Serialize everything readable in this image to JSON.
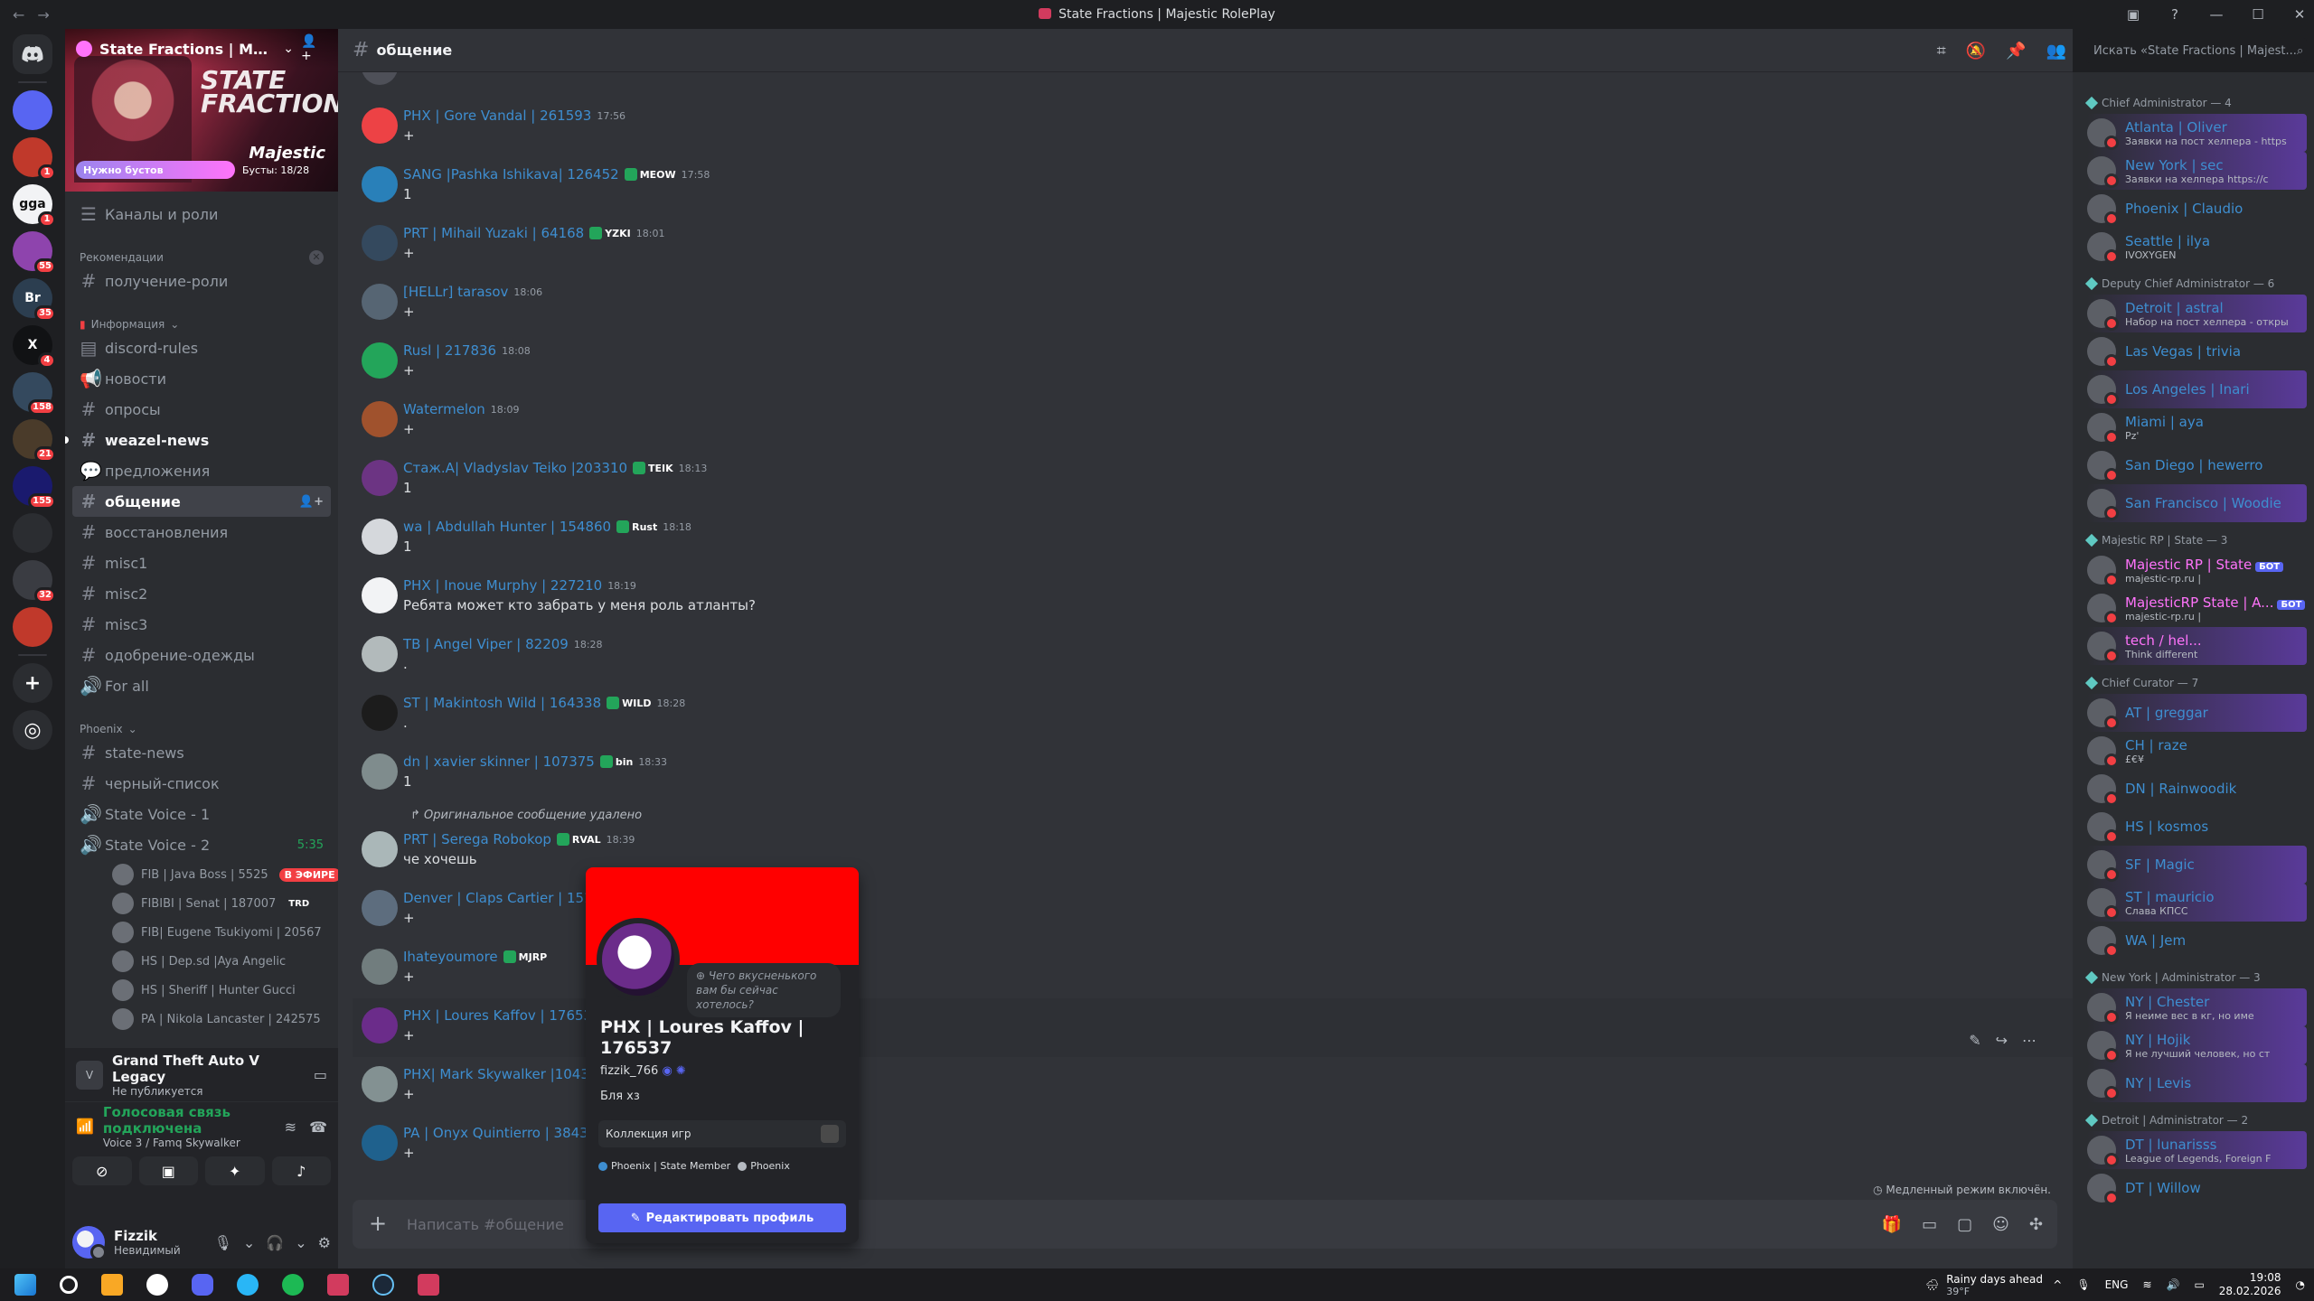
{
  "window": {
    "title": "State Fractions | Majestic RolePlay"
  },
  "guilds": [
    {
      "label": "",
      "color": "#5865f2",
      "badge": ""
    },
    {
      "label": "",
      "color": "#c0392b",
      "badge": "1"
    },
    {
      "label": "gga",
      "color": "#f2f3f5",
      "badge": "1"
    },
    {
      "label": "",
      "color": "#8e44ad",
      "badge": "55"
    },
    {
      "label": "Br",
      "color": "#2c3e50",
      "badge": "35"
    },
    {
      "label": "X",
      "color": "#111214",
      "badge": "4"
    },
    {
      "label": "",
      "color": "#34495e",
      "badge": "158"
    },
    {
      "label": "",
      "color": "#4a3b2a",
      "badge": "21"
    },
    {
      "label": "",
      "color": "#1a1a6e",
      "badge": "155"
    },
    {
      "label": "",
      "color": "#2b2d31",
      "badge": ""
    },
    {
      "label": "",
      "color": "#3a3c42",
      "badge": "32"
    },
    {
      "label": "",
      "color": "#c0392b",
      "badge": ""
    }
  ],
  "server": {
    "name": "State Fractions | Majesti...",
    "banner_text": "STATE FRACTIONS",
    "banner_brand": "Majestic",
    "boost_needed": "Нужно бустов",
    "boost_count": "Бусты: 18/28"
  },
  "channels": {
    "top_item": "Каналы и роли",
    "recommend_cat": "Рекомендации",
    "recommend_items": [
      "получение-роли"
    ],
    "info_cat": "Информация",
    "info_items": [
      {
        "name": "discord-rules",
        "icon": "▤",
        "bold": false,
        "active": false
      },
      {
        "name": "новости",
        "icon": "📢",
        "bold": false,
        "active": false
      },
      {
        "name": "опросы",
        "icon": "#",
        "bold": false,
        "active": false
      },
      {
        "name": "weazel-news",
        "icon": "#",
        "bold": true,
        "active": false
      },
      {
        "name": "предложения",
        "icon": "💬",
        "bold": false,
        "active": false
      },
      {
        "name": "общение",
        "icon": "#",
        "bold": true,
        "active": true
      },
      {
        "name": "восстановления",
        "icon": "#",
        "bold": false,
        "active": false
      },
      {
        "name": "misc1",
        "icon": "#",
        "bold": false,
        "active": false
      },
      {
        "name": "misc2",
        "icon": "#",
        "bold": false,
        "active": false
      },
      {
        "name": "misc3",
        "icon": "#",
        "bold": false,
        "active": false
      },
      {
        "name": "одобрение-одежды",
        "icon": "#",
        "bold": false,
        "active": false
      },
      {
        "name": "For all",
        "icon": "🔊",
        "bold": false,
        "active": false
      }
    ],
    "phoenix_cat": "Phoenix",
    "phoenix_items": [
      {
        "name": "state-news",
        "icon": "#"
      },
      {
        "name": "черный-список",
        "icon": "#"
      },
      {
        "name": "State Voice - 1",
        "icon": "🔊"
      },
      {
        "name": "State Voice - 2",
        "icon": "🔊",
        "time": "5:35"
      }
    ],
    "voice_users": [
      {
        "name": "FIB | Java Boss | 5525",
        "live": "В ЭФИРЕ"
      },
      {
        "name": "FIBIBI | Senat | 187007",
        "tag": "TRD"
      },
      {
        "name": "FIB| Eugene Tsukiyomi | 20567",
        "tag": ""
      },
      {
        "name": "HS | Dep.sd |Aya Angelic",
        "tag": ""
      },
      {
        "name": "HS | Sheriff | Hunter Gucci",
        "tag": ""
      },
      {
        "name": "PA | Nikola Lancaster | 242575",
        "tag": ""
      }
    ]
  },
  "activity": {
    "game": "Grand Theft Auto V Legacy",
    "status": "Не публикуется",
    "voice_title": "Голосовая связь подключена",
    "voice_channel": "Voice 3 / Famq Skywalker"
  },
  "me": {
    "name": "Fizzik",
    "status": "Невидимый"
  },
  "chat": {
    "channel": "общение",
    "search_placeholder": "Искать «State Fractions | Majest...",
    "composer_placeholder": "Написать #общение",
    "slow_mode": "Медленный режим включён.",
    "reply_deleted": "Оригинальное сообщение удалено",
    "messages": [
      {
        "user": "",
        "role": "",
        "time": "",
        "text": "+",
        "color": "#3e8ed0",
        "av": "#4e5058"
      },
      {
        "user": "PHX | Gore Vandal | 261593",
        "role": "",
        "time": "17:56",
        "text": "+",
        "color": "#3e8ed0",
        "av": "#ed4245"
      },
      {
        "user": "SANG |Pashka Ishikava| 126452",
        "role": "MEOW",
        "time": "17:58",
        "text": "1",
        "color": "#3e8ed0",
        "av": "#2980b9"
      },
      {
        "user": "PRT | Mihail Yuzaki | 64168",
        "role": "YZKI",
        "time": "18:01",
        "text": "+",
        "color": "#3e8ed0",
        "av": "#34495e"
      },
      {
        "user": "[HELLr] tarasov",
        "role": "",
        "time": "18:06",
        "text": "+",
        "color": "#3e8ed0",
        "av": "#566573"
      },
      {
        "user": "Rusl | 217836",
        "role": "",
        "time": "18:08",
        "text": "+",
        "color": "#3e8ed0",
        "av": "#23a55a"
      },
      {
        "user": "Watermelon",
        "role": "",
        "time": "18:09",
        "text": "+",
        "color": "#3e8ed0",
        "av": "#a0522d"
      },
      {
        "user": "Стаж.A| Vladyslav Teiko |203310",
        "role": "TEIK",
        "time": "18:13",
        "text": "1",
        "color": "#3e8ed0",
        "av": "#6c3483"
      },
      {
        "user": "wa | Abdullah Hunter | 154860",
        "role": "Rust",
        "time": "18:18",
        "text": "1",
        "color": "#3e8ed0",
        "av": "#d5d8dc"
      },
      {
        "user": "PHX | Inoue Murphy | 227210",
        "role": "",
        "time": "18:19",
        "text": "Ребята может кто забрать у меня роль атланты?",
        "color": "#3e8ed0",
        "av": "#f2f3f5"
      },
      {
        "user": "TB | Angel Viper | 82209",
        "role": "",
        "time": "18:28",
        "text": ".",
        "color": "#3e8ed0",
        "av": "#b2babb"
      },
      {
        "user": "ST | Makintosh Wild | 164338",
        "role": "WILD",
        "time": "18:28",
        "text": ".",
        "color": "#3e8ed0",
        "av": "#1c1c1c"
      },
      {
        "user": "dn | xavier skinner | 107375",
        "role": "bin",
        "time": "18:33",
        "text": "1",
        "color": "#3e8ed0",
        "av": "#7f8c8d"
      }
    ],
    "messages2": [
      {
        "user": "PRT | Serega Robokop",
        "role": "RVAL",
        "time": "18:39",
        "text": "че хочешь",
        "color": "#3e8ed0",
        "av": "#aab7b8"
      },
      {
        "user": "Denver | Claps Cartier | 151757",
        "role": "",
        "time": "",
        "text": "+",
        "color": "#3e8ed0",
        "av": "#5d6d7e"
      },
      {
        "user": "Ihateyoumore",
        "role": "MJRP",
        "time": "",
        "text": "+",
        "color": "#3e8ed0",
        "av": "#717d7e"
      },
      {
        "user": "PHX | Loures Kaffov | 176537",
        "role": "",
        "time": "",
        "text": "+",
        "color": "#3e8ed0",
        "av": "#6b2c8a"
      },
      {
        "user": "PHX| Mark Skywalker |104382",
        "role": "",
        "time": "",
        "text": "+",
        "color": "#3e8ed0",
        "av": "#839192"
      },
      {
        "user": "PA | Onyx Quintierro | 38438",
        "role": "",
        "time": "",
        "text": "+",
        "color": "#3e8ed0",
        "av": "#1f618d"
      }
    ]
  },
  "popout": {
    "status": "Чего вкусненького вам бы сейчас хотелось?",
    "name": "PHX | Loures Kaffov | 176537",
    "username": "fizzik_766",
    "bio": "Бля хз",
    "collection": "Коллекция игр",
    "roles": [
      {
        "name": "Phoenix | State Member",
        "color": "#3e8ed0"
      },
      {
        "name": "Phoenix",
        "color": "#b5bac1"
      }
    ],
    "edit_label": "Редактировать профиль",
    "banner_color": "#ff0000"
  },
  "members": [
    {
      "cat": "Chief Administrator — 4",
      "rows": [
        {
          "name": "Atlanta | Oliver",
          "sub": "Заявки на пост хелпера - https",
          "color": "#3e8ed0",
          "grad": true
        },
        {
          "name": "New York | sec",
          "sub": "Заявки на хелпера https://c",
          "color": "#3e8ed0",
          "grad": true
        },
        {
          "name": "Phoenix | Claudio",
          "sub": "",
          "color": "#3e8ed0",
          "grad": false
        },
        {
          "name": "Seattle | ilya",
          "sub": "IVOXYGEN",
          "color": "#3e8ed0",
          "grad": false
        }
      ]
    },
    {
      "cat": "Deputy Chief Administrator — 6",
      "rows": [
        {
          "name": "Detroit | astral",
          "sub": "Набор на пост хелпера - откры",
          "color": "#3e8ed0",
          "grad": true
        },
        {
          "name": "Las Vegas | trivia",
          "sub": "",
          "color": "#3e8ed0",
          "grad": false
        },
        {
          "name": "Los Angeles | Inari",
          "sub": "",
          "color": "#3e8ed0",
          "grad": true
        },
        {
          "name": "Miami | aya",
          "sub": "Pz'",
          "color": "#3e8ed0",
          "grad": false
        },
        {
          "name": "San Diego | hewerro",
          "sub": "",
          "color": "#3e8ed0",
          "grad": false
        },
        {
          "name": "San Francisco | Woodie",
          "sub": "",
          "color": "#3e8ed0",
          "grad": true
        }
      ]
    },
    {
      "cat": "Majestic RP | State — 3",
      "rows": [
        {
          "name": "Majestic RP | State",
          "sub": "majestic-rp.ru |",
          "color": "#ff73fa",
          "grad": false,
          "bot": "БОТ"
        },
        {
          "name": "MajesticRP State | A...",
          "sub": "majestic-rp.ru |",
          "color": "#ff73fa",
          "grad": false,
          "bot": "БОТ"
        },
        {
          "name": "tech / hel...",
          "sub": "Think different",
          "color": "#ff73fa",
          "grad": true
        }
      ]
    },
    {
      "cat": "Chief Curator — 7",
      "rows": [
        {
          "name": "AT | greggar",
          "sub": "",
          "color": "#3e8ed0",
          "grad": true
        },
        {
          "name": "CH | raze",
          "sub": "£€¥",
          "color": "#3e8ed0",
          "grad": false
        },
        {
          "name": "DN | Rainwoodik",
          "sub": "",
          "color": "#3e8ed0",
          "grad": false
        },
        {
          "name": "HS | kosmos",
          "sub": "",
          "color": "#3e8ed0",
          "grad": false
        },
        {
          "name": "SF | Magic",
          "sub": "",
          "color": "#3e8ed0",
          "grad": true
        },
        {
          "name": "ST | mauricio",
          "sub": "Слава КПСС",
          "color": "#3e8ed0",
          "grad": true
        },
        {
          "name": "WA | Jem",
          "sub": "",
          "color": "#3e8ed0",
          "grad": false
        }
      ]
    },
    {
      "cat": "New York | Administrator — 3",
      "rows": [
        {
          "name": "NY | Chester",
          "sub": "Я неиме вес в кг, но име",
          "color": "#3e8ed0",
          "grad": true
        },
        {
          "name": "NY | Hojik",
          "sub": "Я не лучший человек, но ст",
          "color": "#3e8ed0",
          "grad": true
        },
        {
          "name": "NY | Levis",
          "sub": "",
          "color": "#3e8ed0",
          "grad": true
        }
      ]
    },
    {
      "cat": "Detroit | Administrator — 2",
      "rows": [
        {
          "name": "DT | lunarisss",
          "sub": "League of Legends, Foreign F",
          "color": "#3e8ed0",
          "grad": true
        },
        {
          "name": "DT | Willow",
          "sub": "",
          "color": "#3e8ed0",
          "grad": false
        }
      ]
    }
  ],
  "taskbar": {
    "weather_title": "Rainy days ahead",
    "weather_temp": "39°F",
    "lang": "ENG",
    "time": "19:08",
    "date": "28.02.2026"
  }
}
